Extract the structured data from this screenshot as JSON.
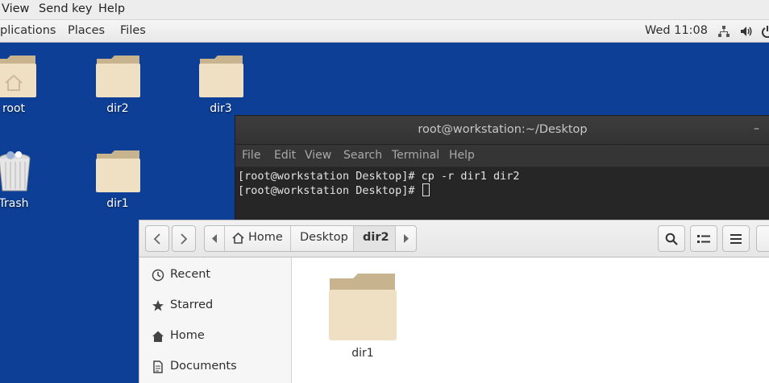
{
  "vm_menubar": {
    "items": [
      "View",
      "Send key",
      "Help"
    ]
  },
  "topbar": {
    "items": [
      "plications",
      "Places",
      "Files"
    ],
    "clock": "Wed 11:08"
  },
  "desktop": {
    "icons": [
      {
        "label": "root",
        "icon": "home-folder-icon"
      },
      {
        "label": "dir2",
        "icon": "folder-icon"
      },
      {
        "label": "dir3",
        "icon": "folder-icon"
      },
      {
        "label": "Trash",
        "icon": "trash-icon"
      },
      {
        "label": "dir1",
        "icon": "folder-icon"
      }
    ]
  },
  "terminal": {
    "title": "root@workstation:~/Desktop",
    "menu": [
      "File",
      "Edit",
      "View",
      "Search",
      "Terminal",
      "Help"
    ],
    "lines": [
      "[root@workstation Desktop]# cp -r dir1 dir2",
      "[root@workstation Desktop]# "
    ]
  },
  "files": {
    "path": [
      "Home",
      "Desktop",
      "dir2"
    ],
    "sidebar": [
      "Recent",
      "Starred",
      "Home",
      "Documents"
    ],
    "items": [
      {
        "label": "dir1",
        "icon": "folder-icon"
      }
    ]
  },
  "colors": {
    "desktop_bg": "#0d3f96",
    "folder_front": "#efdfc3",
    "folder_back": "#c7b48e",
    "terminal_bg": "#262626"
  }
}
